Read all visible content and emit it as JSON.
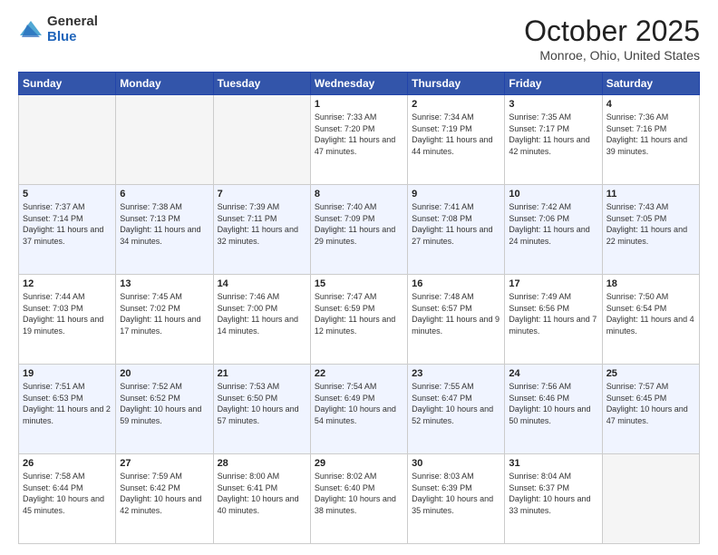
{
  "header": {
    "logo_general": "General",
    "logo_blue": "Blue",
    "month_title": "October 2025",
    "location": "Monroe, Ohio, United States"
  },
  "days_of_week": [
    "Sunday",
    "Monday",
    "Tuesday",
    "Wednesday",
    "Thursday",
    "Friday",
    "Saturday"
  ],
  "weeks": [
    [
      {
        "day": "",
        "empty": true
      },
      {
        "day": "",
        "empty": true
      },
      {
        "day": "",
        "empty": true
      },
      {
        "day": "1",
        "sunrise": "7:33 AM",
        "sunset": "7:20 PM",
        "daylight": "11 hours and 47 minutes."
      },
      {
        "day": "2",
        "sunrise": "7:34 AM",
        "sunset": "7:19 PM",
        "daylight": "11 hours and 44 minutes."
      },
      {
        "day": "3",
        "sunrise": "7:35 AM",
        "sunset": "7:17 PM",
        "daylight": "11 hours and 42 minutes."
      },
      {
        "day": "4",
        "sunrise": "7:36 AM",
        "sunset": "7:16 PM",
        "daylight": "11 hours and 39 minutes."
      }
    ],
    [
      {
        "day": "5",
        "sunrise": "7:37 AM",
        "sunset": "7:14 PM",
        "daylight": "11 hours and 37 minutes."
      },
      {
        "day": "6",
        "sunrise": "7:38 AM",
        "sunset": "7:13 PM",
        "daylight": "11 hours and 34 minutes."
      },
      {
        "day": "7",
        "sunrise": "7:39 AM",
        "sunset": "7:11 PM",
        "daylight": "11 hours and 32 minutes."
      },
      {
        "day": "8",
        "sunrise": "7:40 AM",
        "sunset": "7:09 PM",
        "daylight": "11 hours and 29 minutes."
      },
      {
        "day": "9",
        "sunrise": "7:41 AM",
        "sunset": "7:08 PM",
        "daylight": "11 hours and 27 minutes."
      },
      {
        "day": "10",
        "sunrise": "7:42 AM",
        "sunset": "7:06 PM",
        "daylight": "11 hours and 24 minutes."
      },
      {
        "day": "11",
        "sunrise": "7:43 AM",
        "sunset": "7:05 PM",
        "daylight": "11 hours and 22 minutes."
      }
    ],
    [
      {
        "day": "12",
        "sunrise": "7:44 AM",
        "sunset": "7:03 PM",
        "daylight": "11 hours and 19 minutes."
      },
      {
        "day": "13",
        "sunrise": "7:45 AM",
        "sunset": "7:02 PM",
        "daylight": "11 hours and 17 minutes."
      },
      {
        "day": "14",
        "sunrise": "7:46 AM",
        "sunset": "7:00 PM",
        "daylight": "11 hours and 14 minutes."
      },
      {
        "day": "15",
        "sunrise": "7:47 AM",
        "sunset": "6:59 PM",
        "daylight": "11 hours and 12 minutes."
      },
      {
        "day": "16",
        "sunrise": "7:48 AM",
        "sunset": "6:57 PM",
        "daylight": "11 hours and 9 minutes."
      },
      {
        "day": "17",
        "sunrise": "7:49 AM",
        "sunset": "6:56 PM",
        "daylight": "11 hours and 7 minutes."
      },
      {
        "day": "18",
        "sunrise": "7:50 AM",
        "sunset": "6:54 PM",
        "daylight": "11 hours and 4 minutes."
      }
    ],
    [
      {
        "day": "19",
        "sunrise": "7:51 AM",
        "sunset": "6:53 PM",
        "daylight": "11 hours and 2 minutes."
      },
      {
        "day": "20",
        "sunrise": "7:52 AM",
        "sunset": "6:52 PM",
        "daylight": "10 hours and 59 minutes."
      },
      {
        "day": "21",
        "sunrise": "7:53 AM",
        "sunset": "6:50 PM",
        "daylight": "10 hours and 57 minutes."
      },
      {
        "day": "22",
        "sunrise": "7:54 AM",
        "sunset": "6:49 PM",
        "daylight": "10 hours and 54 minutes."
      },
      {
        "day": "23",
        "sunrise": "7:55 AM",
        "sunset": "6:47 PM",
        "daylight": "10 hours and 52 minutes."
      },
      {
        "day": "24",
        "sunrise": "7:56 AM",
        "sunset": "6:46 PM",
        "daylight": "10 hours and 50 minutes."
      },
      {
        "day": "25",
        "sunrise": "7:57 AM",
        "sunset": "6:45 PM",
        "daylight": "10 hours and 47 minutes."
      }
    ],
    [
      {
        "day": "26",
        "sunrise": "7:58 AM",
        "sunset": "6:44 PM",
        "daylight": "10 hours and 45 minutes."
      },
      {
        "day": "27",
        "sunrise": "7:59 AM",
        "sunset": "6:42 PM",
        "daylight": "10 hours and 42 minutes."
      },
      {
        "day": "28",
        "sunrise": "8:00 AM",
        "sunset": "6:41 PM",
        "daylight": "10 hours and 40 minutes."
      },
      {
        "day": "29",
        "sunrise": "8:02 AM",
        "sunset": "6:40 PM",
        "daylight": "10 hours and 38 minutes."
      },
      {
        "day": "30",
        "sunrise": "8:03 AM",
        "sunset": "6:39 PM",
        "daylight": "10 hours and 35 minutes."
      },
      {
        "day": "31",
        "sunrise": "8:04 AM",
        "sunset": "6:37 PM",
        "daylight": "10 hours and 33 minutes."
      },
      {
        "day": "",
        "empty": true
      }
    ]
  ],
  "labels": {
    "sunrise_prefix": "Sunrise:",
    "sunset_prefix": "Sunset:",
    "daylight_prefix": "Daylight:"
  }
}
